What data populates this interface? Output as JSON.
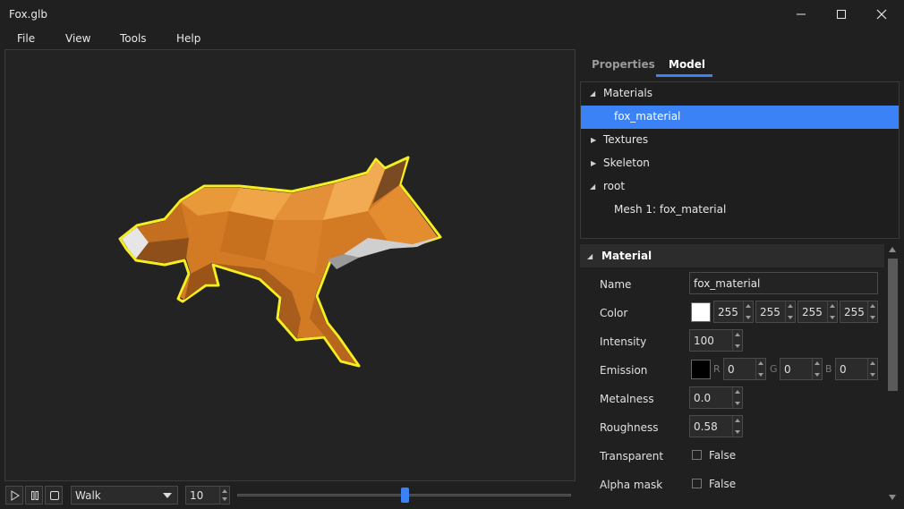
{
  "window": {
    "title": "Fox.glb",
    "controls": [
      "minimize-icon",
      "maximize-icon",
      "close-icon"
    ]
  },
  "menu": {
    "items": [
      "File",
      "View",
      "Tools",
      "Help"
    ]
  },
  "viewport": {
    "model_name": "fox",
    "selection_color": "#f5ee20",
    "background": "#232323"
  },
  "playback": {
    "controls": [
      "play-icon",
      "pause-icon",
      "stop-icon"
    ],
    "animation": "Walk",
    "speed": "10",
    "timeline_progress": 0.5
  },
  "tabs": [
    {
      "label": "Properties",
      "active": false
    },
    {
      "label": "Model",
      "active": true
    }
  ],
  "tree": {
    "items": [
      {
        "label": "Materials",
        "expanded": true,
        "depth": 0
      },
      {
        "label": "fox_material",
        "selected": true,
        "depth": 1
      },
      {
        "label": "Textures",
        "expanded": false,
        "depth": 0
      },
      {
        "label": "Skeleton",
        "expanded": false,
        "depth": 0
      },
      {
        "label": "root",
        "expanded": true,
        "depth": 0
      },
      {
        "label": "Mesh 1: fox_material",
        "depth": 1
      }
    ]
  },
  "material": {
    "section_title": "Material",
    "name_label": "Name",
    "name_value": "fox_material",
    "color_label": "Color",
    "color_swatch": "#ffffff",
    "color_values": [
      "255",
      "255",
      "255",
      "255"
    ],
    "intensity_label": "Intensity",
    "intensity_value": "100",
    "emission_label": "Emission",
    "emission_swatch": "#000000",
    "emission_channels": [
      {
        "channel": "R",
        "value": "0"
      },
      {
        "channel": "G",
        "value": "0"
      },
      {
        "channel": "B",
        "value": "0"
      }
    ],
    "metalness_label": "Metalness",
    "metalness_value": "0.0",
    "roughness_label": "Roughness",
    "roughness_value": "0.58",
    "transparent_label": "Transparent",
    "transparent_value": "False",
    "alphamask_label": "Alpha mask",
    "alphamask_value": "False"
  },
  "accent_color": "#3b82f6"
}
